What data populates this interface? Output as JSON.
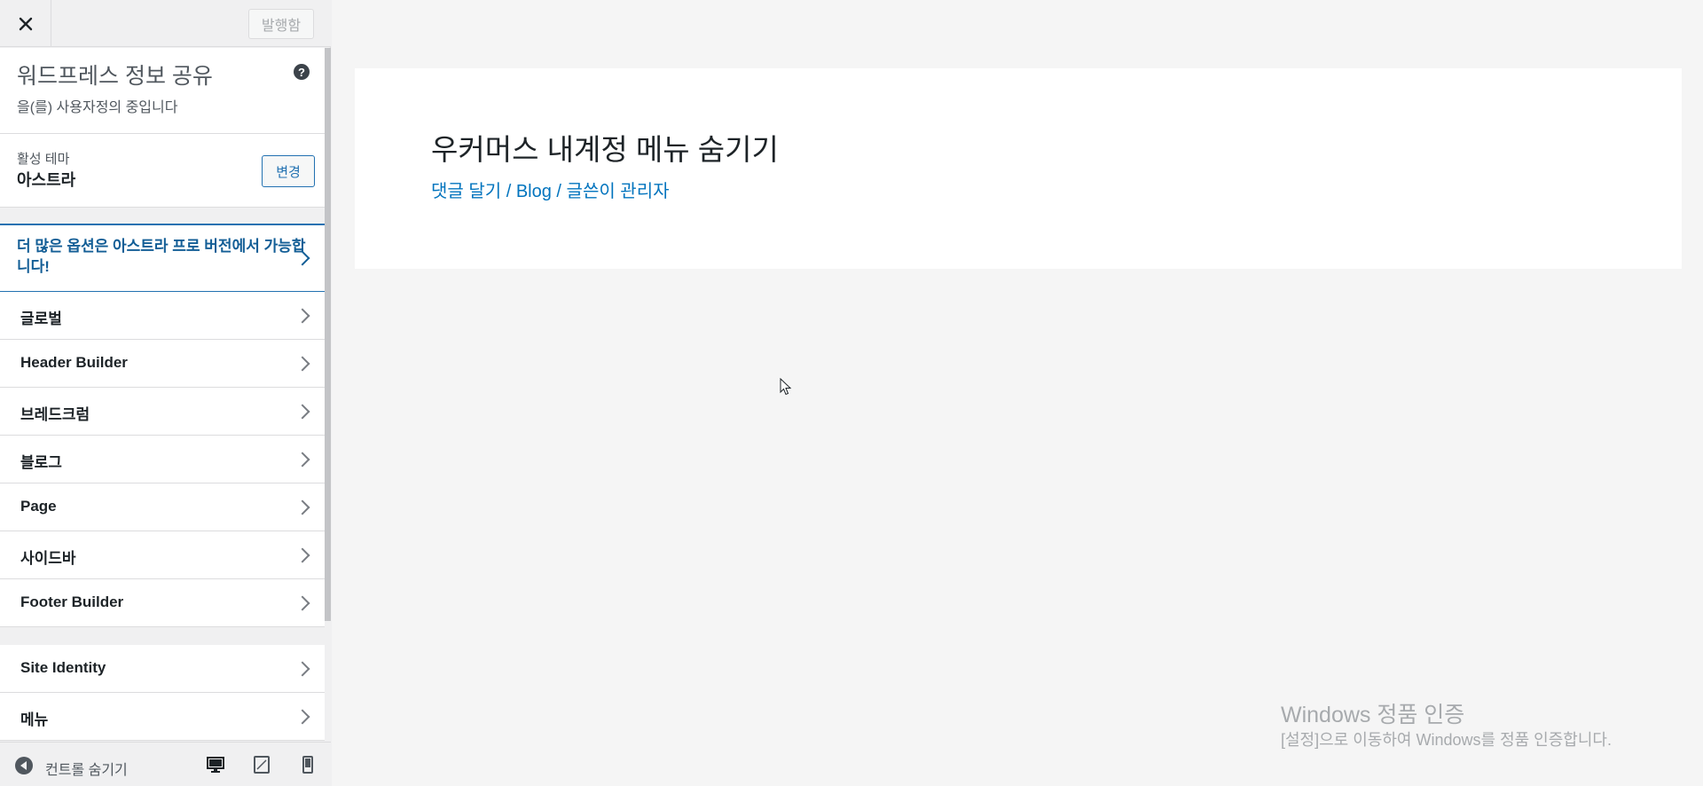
{
  "topbar": {
    "close_label": "×",
    "publish_label": "발행함"
  },
  "info": {
    "title": "워드프레스 정보 공유",
    "subtitle": "을(를) 사용자정의 중입니다",
    "help_label": "?"
  },
  "theme": {
    "label": "활성 테마",
    "name": "아스트라",
    "change_label": "변경"
  },
  "pro_banner": {
    "text": "더 많은 옵션은 아스트라 프로 버전에서 가능합니다!"
  },
  "menu_group1": [
    {
      "label": "글로벌"
    },
    {
      "label": "Header Builder"
    },
    {
      "label": "브레드크럼"
    },
    {
      "label": "블로그"
    },
    {
      "label": "Page"
    },
    {
      "label": "사이드바"
    },
    {
      "label": "Footer Builder"
    }
  ],
  "menu_group2": [
    {
      "label": "Site Identity"
    },
    {
      "label": "메뉴"
    }
  ],
  "bottombar": {
    "collapse_label": "컨트롤 숨기기",
    "devices": [
      "desktop-icon",
      "tablet-icon",
      "mobile-icon"
    ]
  },
  "preview": {
    "post_title": "우커머스 내계정 메뉴 숨기기",
    "meta_comment": "댓글 달기",
    "meta_sep": " / ",
    "meta_category": "Blog",
    "meta_author": "글쓴이 관리자"
  },
  "watermark": {
    "title": "Windows 정품 인증",
    "subtitle": "[설정]으로 이동하여 Windows를 정품 인증합니다."
  },
  "colors": {
    "accent": "#2271b1",
    "link": "#0274be"
  }
}
